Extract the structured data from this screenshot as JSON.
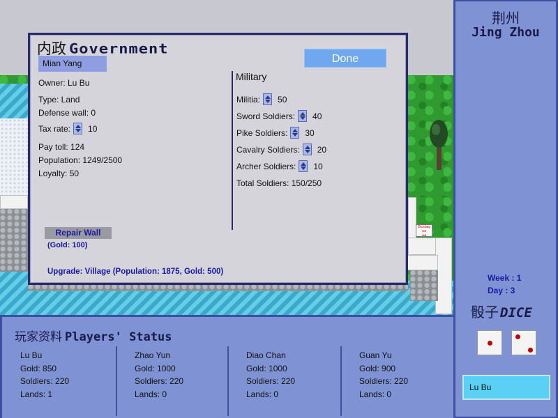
{
  "government": {
    "title_cn": "内政",
    "title_en": "Government",
    "city_name": "Mian Yang",
    "done_label": "Done",
    "owner": "Owner: Lu Bu",
    "type": "Type: Land",
    "defense_wall": "Defense wall: 0",
    "tax_rate_label": "Tax rate:",
    "tax_rate_value": "10",
    "pay_toll": "Pay toll: 124",
    "population": "Population: 1249/2500",
    "loyalty": "Loyalty: 50",
    "repair_wall_label": "Repair Wall",
    "repair_wall_cost": "(Gold: 100)",
    "upgrade": "Upgrade: Village (Population: 1875, Gold: 500)"
  },
  "military": {
    "heading": "Military",
    "units": [
      {
        "label": "Militia:",
        "value": "50"
      },
      {
        "label": "Sword Soldiers:",
        "value": "40"
      },
      {
        "label": "Pike Soldiers:",
        "value": "30"
      },
      {
        "label": "Cavalry Soldiers:",
        "value": "20"
      },
      {
        "label": "Archer Soldiers:",
        "value": "10"
      }
    ],
    "total": "Total Soldiers: 150/250"
  },
  "region": {
    "name_cn": "荆州",
    "name_en": "Jing Zhou"
  },
  "calendar": {
    "week": "Week : 1",
    "day": "Day : 3"
  },
  "dice": {
    "title_cn": "骰子",
    "title_en": "DICE",
    "values": [
      1,
      2
    ]
  },
  "current_player": "Lu Bu",
  "map": {
    "sign_text": "Dicebag"
  },
  "players_status": {
    "title_cn": "玩家资料",
    "title_en": "Players' Status",
    "players": [
      {
        "name": "Lu Bu",
        "gold": "Gold: 850",
        "soldiers": "Soldiers: 220",
        "lands": "Lands: 1"
      },
      {
        "name": "Zhao Yun",
        "gold": "Gold: 1000",
        "soldiers": "Soldiers: 220",
        "lands": "Lands: 0"
      },
      {
        "name": "Diao Chan",
        "gold": "Gold: 1000",
        "soldiers": "Soldiers: 220",
        "lands": "Lands: 0"
      },
      {
        "name": "Guan Yu",
        "gold": "Gold: 900",
        "soldiers": "Soldiers: 220",
        "lands": "Lands: 0"
      }
    ]
  },
  "colors": {
    "panel_blue": "#7f93d4",
    "panel_border": "#3c4fa0",
    "done_button": "#6fa8ee",
    "current_player_bg": "#5ad0f4",
    "die_pip": "#bb0000"
  }
}
